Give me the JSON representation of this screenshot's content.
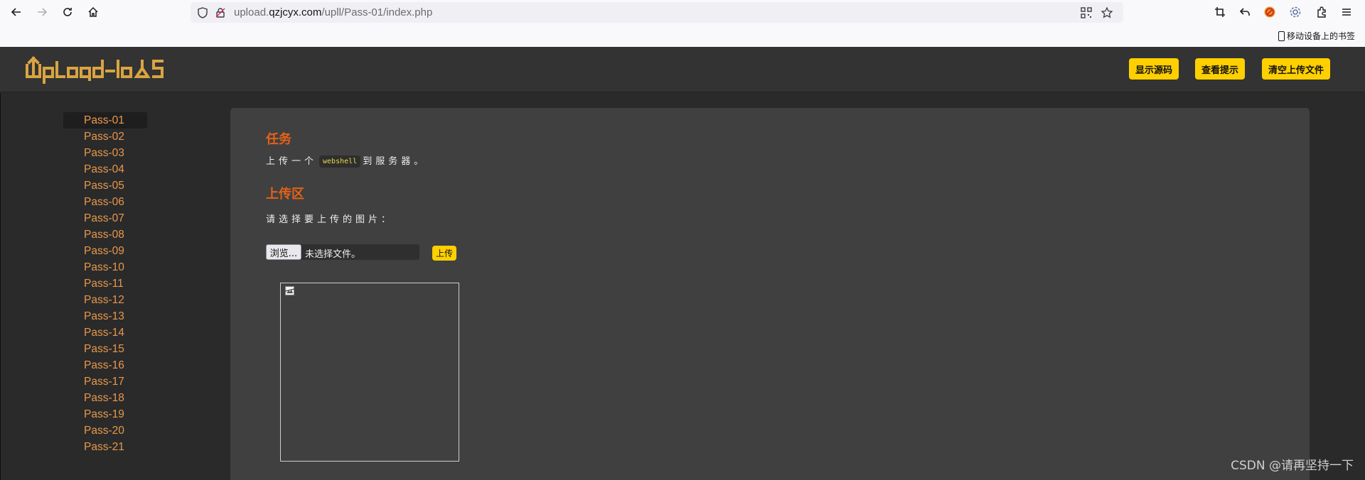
{
  "browser": {
    "url_prefix": "upload.",
    "url_domain": "qzjcyx.com",
    "url_path": "/upll/Pass-01/index.php",
    "mobile_bookmarks": "移动设备上的书签"
  },
  "header": {
    "logo_text": "Upload-labs",
    "buttons": [
      "显示源码",
      "查看提示",
      "清空上传文件"
    ],
    "button_color": "#ffd000"
  },
  "sidebar": {
    "items": [
      "Pass-01",
      "Pass-02",
      "Pass-03",
      "Pass-04",
      "Pass-05",
      "Pass-06",
      "Pass-07",
      "Pass-08",
      "Pass-09",
      "Pass-10",
      "Pass-11",
      "Pass-12",
      "Pass-13",
      "Pass-14",
      "Pass-15",
      "Pass-16",
      "Pass-17",
      "Pass-18",
      "Pass-19",
      "Pass-20",
      "Pass-21"
    ],
    "active": "Pass-01"
  },
  "task": {
    "title": "任务",
    "text_before": "上传一个",
    "code": "webshell",
    "text_after": "到服务器。"
  },
  "upload": {
    "title": "上传区",
    "prompt": "请选择要上传的图片：",
    "browse_label": "浏览...",
    "file_status": "未选择文件。",
    "submit_label": "上传"
  },
  "watermark": "CSDN @请再坚持一下",
  "colors": {
    "accent": "#e46218",
    "link": "#e8974b",
    "panel": "#404040"
  }
}
